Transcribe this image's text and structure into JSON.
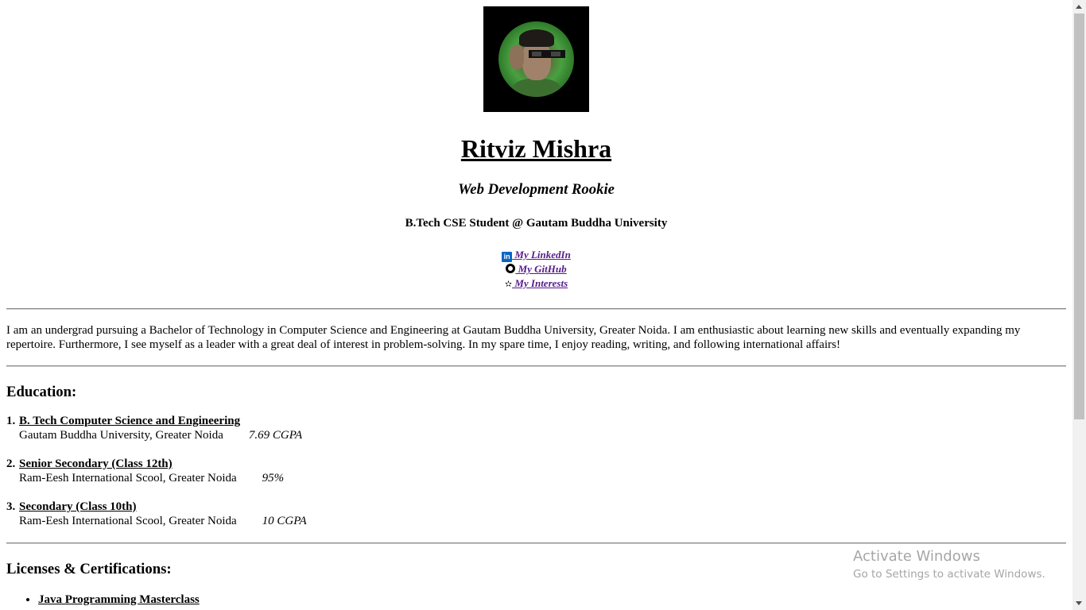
{
  "profile": {
    "name": "Ritviz Mishra",
    "tagline": "Web Development Rookie",
    "school": "B.Tech CSE Student @ Gautam Buddha University"
  },
  "links": [
    {
      "label": " My LinkedIn",
      "icon": "linkedin-icon"
    },
    {
      "label": " My GitHub",
      "icon": "github-icon"
    },
    {
      "label": " My Interests",
      "icon": "star-icon"
    }
  ],
  "about": "I am an undergrad pursuing a Bachelor of Technology in Computer Science and Engineering at Gautam Buddha University, Greater Noida. I am enthusiastic about learning new skills and eventually expanding my repertoire. Furthermore, I see myself as a leader with a great deal of interest in problem-solving. In my spare time, I enjoy reading, writing, and following international affairs!",
  "education": {
    "heading": "Education:",
    "items": [
      {
        "num": "1.",
        "degree": "B. Tech Computer Science and Engineering",
        "institution": "Gautam Buddha University, Greater Noida",
        "score": "7.69 CGPA"
      },
      {
        "num": "2.",
        "degree": "Senior Secondary (Class 12th)",
        "institution": "Ram-Eesh International Scool, Greater Noida",
        "score": "95%"
      },
      {
        "num": "3.",
        "degree": "Secondary (Class 10th)",
        "institution": "Ram-Eesh International Scool, Greater Noida",
        "score": "10 CGPA"
      }
    ]
  },
  "certifications": {
    "heading": "Licenses & Certifications:",
    "items": [
      {
        "title": "Java Programming Masterclass"
      }
    ]
  },
  "watermark": {
    "line1": "Activate Windows",
    "line2": "Go to Settings to activate Windows."
  },
  "colors": {
    "link": "#551a8b",
    "linkedin": "#0a66c2",
    "watermark": "#a6a6a6"
  }
}
